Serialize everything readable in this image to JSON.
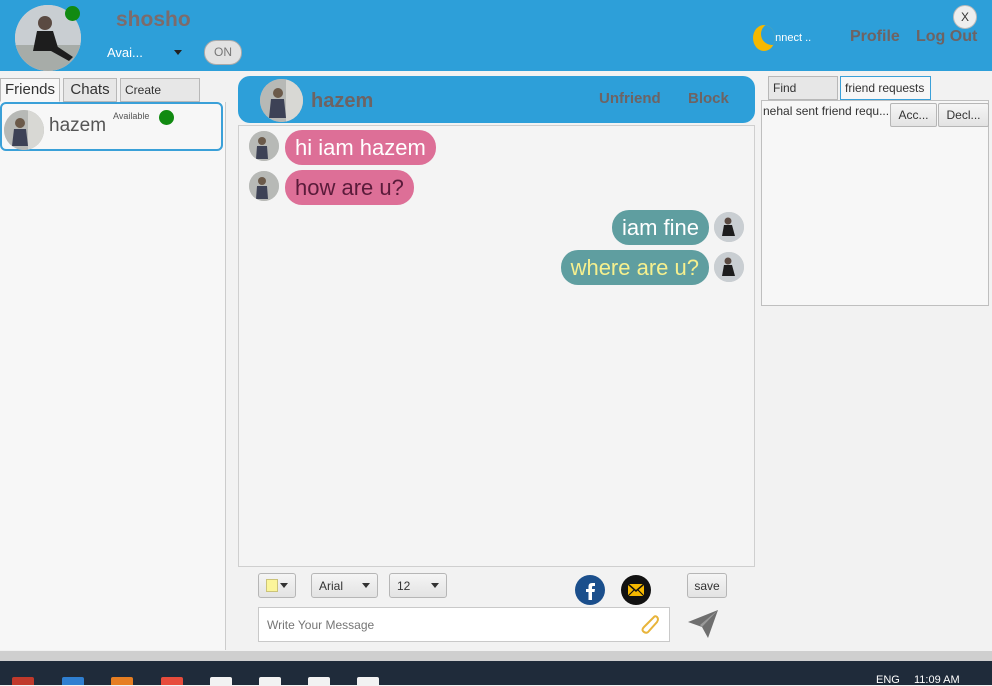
{
  "header": {
    "user_name": "shosho",
    "status_value": "Avai...",
    "toggle_label": "ON",
    "connect_label": "onnect ..",
    "profile_label": "Profile",
    "logout_label": "Log Out",
    "close_label": "X"
  },
  "left_tabs": {
    "friends": "Friends",
    "chats": "Chats",
    "create_group": "Create Group"
  },
  "friends": [
    {
      "name": "hazem",
      "status": "Available",
      "status_color": "#118a11"
    }
  ],
  "chat": {
    "contact_name": "hazem",
    "unfriend_label": "Unfriend",
    "block_label": "Block",
    "messages": [
      {
        "text": "hi iam hazem",
        "direction": "in",
        "color": "#ffffff"
      },
      {
        "text": "how are u?",
        "direction": "in",
        "color": "#5a1b3a"
      },
      {
        "text": "iam fine",
        "direction": "out",
        "color": "#ffffff"
      },
      {
        "text": "where are u?",
        "direction": "out",
        "color": "#f6f08e"
      }
    ]
  },
  "composer": {
    "text_color": "#fbf59a",
    "font_value": "Arial",
    "size_value": "12",
    "save_label": "save",
    "placeholder": "Write Your Message",
    "icons": [
      "facebook-icon",
      "mail-icon",
      "attach-icon",
      "send-icon"
    ]
  },
  "right_tabs": {
    "find_friends": "Find friends",
    "friend_requests": "friend requests"
  },
  "requests": [
    {
      "text": "nehal sent friend requ...",
      "accept_label": "Acc...",
      "decline_label": "Decl..."
    }
  ],
  "taskbar": {
    "language": "ENG",
    "time": "11:09 AM"
  },
  "colors": {
    "header_blue": "#2d9fd9",
    "incoming_bubble": "#dd6f97",
    "outgoing_bubble": "#5f9ea0",
    "online": "#118a11"
  }
}
